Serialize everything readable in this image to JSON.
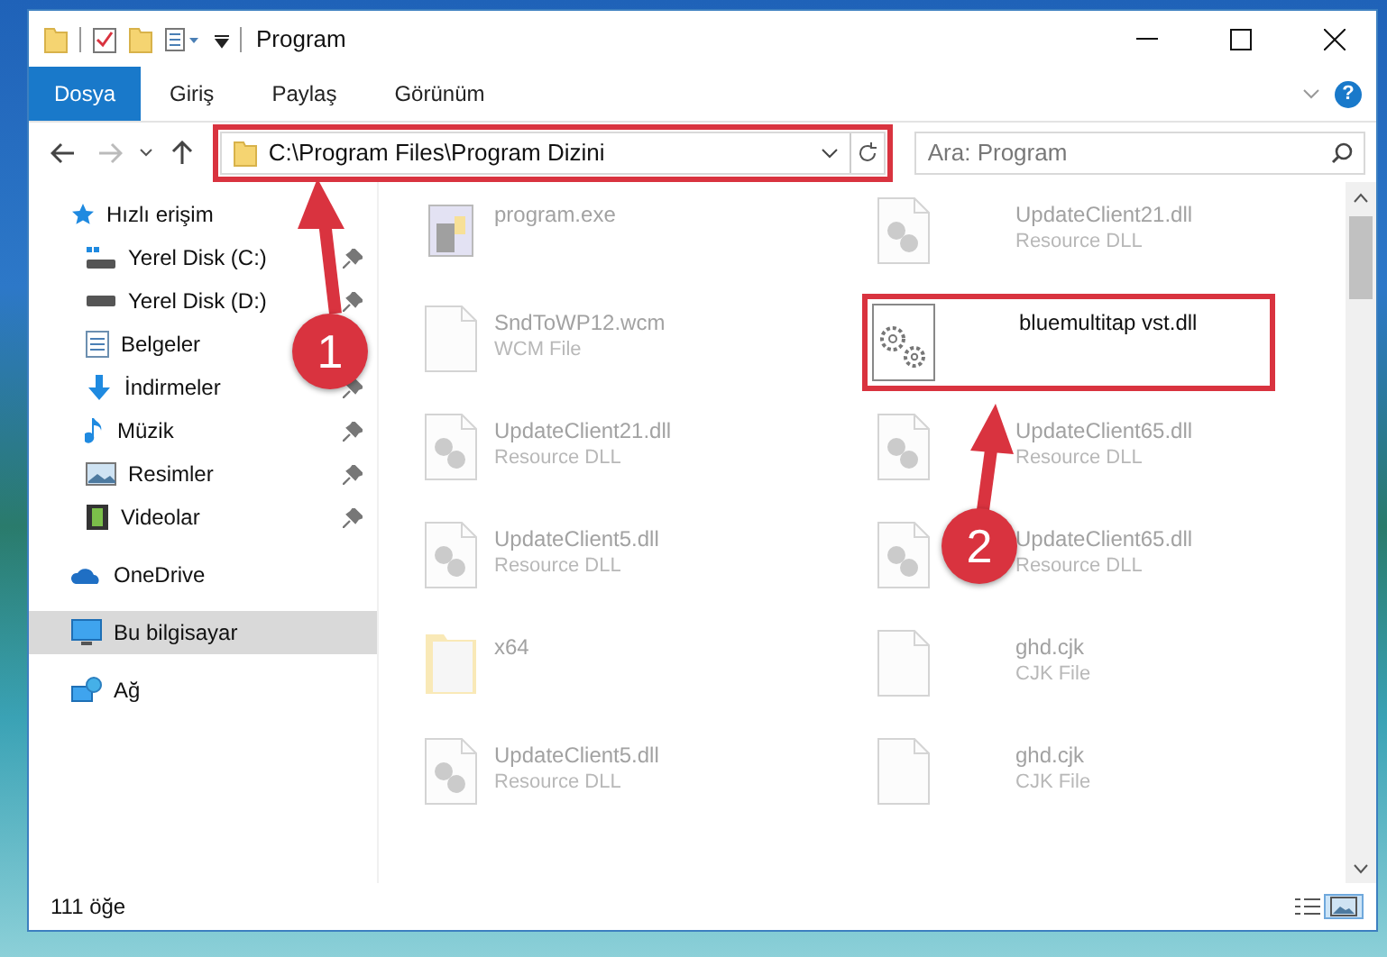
{
  "window": {
    "title": "Program"
  },
  "ribbon": {
    "tabs": [
      {
        "label": "Dosya",
        "selected": true
      },
      {
        "label": "Giriş",
        "selected": false
      },
      {
        "label": "Paylaş",
        "selected": false
      },
      {
        "label": "Görünüm",
        "selected": false
      }
    ],
    "help": "?"
  },
  "address": {
    "path": "C:\\Program Files\\Program Dizini",
    "highlighted": true
  },
  "search": {
    "placeholder": "Ara: Program"
  },
  "sidebar": {
    "items": [
      {
        "label": "Hızlı erişim",
        "selected": false,
        "children": [
          {
            "label": "Yerel Disk (C:)",
            "pinned": true
          },
          {
            "label": "Yerel Disk (D:)",
            "pinned": true
          },
          {
            "label": "Belgeler",
            "pinned": false
          },
          {
            "label": "İndirmeler",
            "pinned": true
          },
          {
            "label": "Müzik",
            "pinned": true
          },
          {
            "label": "Resimler",
            "pinned": true
          },
          {
            "label": "Videolar",
            "pinned": true
          }
        ]
      },
      {
        "label": "OneDrive",
        "selected": false
      },
      {
        "label": "Bu bilgisayar",
        "selected": true
      },
      {
        "label": "Ağ",
        "selected": false
      }
    ]
  },
  "files": [
    {
      "name": "program.exe",
      "kind": "exe",
      "dimmed": true,
      "highlighted": false
    },
    {
      "name": "UpdateClient21.dll",
      "type": "Resource DLL",
      "kind": "dll",
      "dimmed": true,
      "highlighted": false
    },
    {
      "name": "SndToWP12.wcm",
      "type": "WCM File",
      "kind": "file",
      "dimmed": true,
      "highlighted": false
    },
    {
      "name": "bluemultitap vst.dll",
      "kind": "gear",
      "dimmed": false,
      "highlighted": true
    },
    {
      "name": "UpdateClient21.dll",
      "type": "Resource DLL",
      "kind": "dll",
      "dimmed": true,
      "highlighted": false
    },
    {
      "name": "UpdateClient65.dll",
      "type": "Resource DLL",
      "kind": "dll",
      "dimmed": true,
      "highlighted": false
    },
    {
      "name": "UpdateClient5.dll",
      "type": "Resource DLL",
      "kind": "dll",
      "dimmed": true,
      "highlighted": false
    },
    {
      "name": "UpdateClient65.dll",
      "type": "Resource DLL",
      "kind": "dll",
      "dimmed": true,
      "highlighted": false
    },
    {
      "name": "x64",
      "kind": "folder",
      "dimmed": true,
      "highlighted": false
    },
    {
      "name": "ghd.cjk",
      "type": "CJK File",
      "kind": "file",
      "dimmed": true,
      "highlighted": false
    },
    {
      "name": "UpdateClient5.dll",
      "type": "Resource DLL",
      "kind": "dll",
      "dimmed": true,
      "highlighted": false
    },
    {
      "name": "ghd.cjk",
      "type": "CJK File",
      "kind": "file",
      "dimmed": true,
      "highlighted": false
    }
  ],
  "status_bar": {
    "count": "111 öğe"
  },
  "annotations": [
    {
      "label": "1"
    },
    {
      "label": "2"
    }
  ]
}
